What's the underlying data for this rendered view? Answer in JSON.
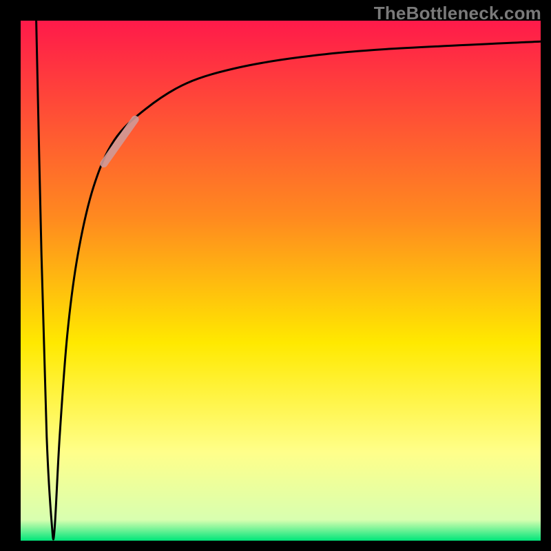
{
  "watermark": "TheBottleneck.com",
  "colors": {
    "top": "#ff1a4a",
    "mid_upper": "#ff8a1f",
    "mid": "#ffe900",
    "mid_lower": "#ffff8a",
    "bottom": "#00e57a",
    "curve": "#000000",
    "highlight": "#cf9a98",
    "frame": "#000000"
  },
  "chart_data": {
    "type": "line",
    "title": "",
    "xlabel": "",
    "ylabel": "",
    "xlim": [
      0,
      100
    ],
    "ylim": [
      0,
      100
    ],
    "x": [
      3,
      4,
      5,
      6,
      6.5,
      7.5,
      9,
      11,
      14,
      18,
      24,
      32,
      42,
      54,
      70,
      100
    ],
    "values": [
      100,
      55,
      20,
      3,
      2,
      20,
      40,
      55,
      68,
      77,
      83,
      88,
      91,
      93,
      94.5,
      96
    ],
    "annotations": [
      {
        "kind": "highlight-segment",
        "x_range": [
          16,
          22
        ],
        "note": "thick pale-rose stroke overlay on the rising part of the curve"
      }
    ],
    "background_gradient_stops": [
      {
        "offset": 0.0,
        "color": "#ff1a4a"
      },
      {
        "offset": 0.38,
        "color": "#ff8a1f"
      },
      {
        "offset": 0.62,
        "color": "#ffe900"
      },
      {
        "offset": 0.83,
        "color": "#ffff8a"
      },
      {
        "offset": 0.96,
        "color": "#d8ffb0"
      },
      {
        "offset": 1.0,
        "color": "#00e57a"
      }
    ]
  }
}
